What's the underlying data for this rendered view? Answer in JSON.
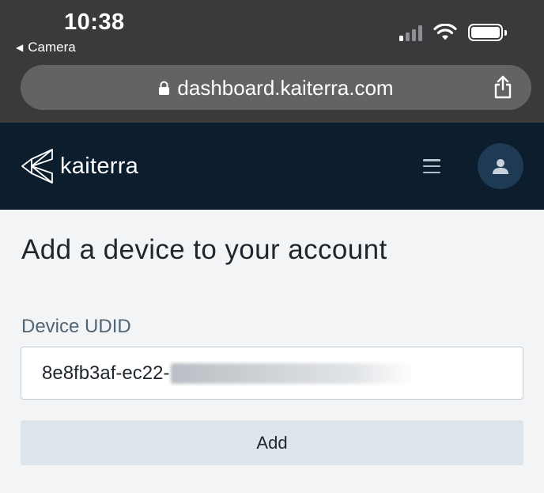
{
  "status_bar": {
    "time": "10:38",
    "back_app": "Camera"
  },
  "browser": {
    "url": "dashboard.kaiterra.com",
    "icons": [
      "lock-icon",
      "share-icon",
      "signal-icon",
      "wifi-icon",
      "battery-icon"
    ]
  },
  "app_header": {
    "logo_text": "kaiterra",
    "icons": [
      "kaiterra-logo-icon",
      "menu-icon",
      "user-icon"
    ]
  },
  "main": {
    "title": "Add a device to your account",
    "udid": {
      "label": "Device UDID",
      "value_visible": "8e8fb3af-ec22-"
    },
    "add_button": "Add"
  },
  "colors": {
    "chrome": "#3a3a3c",
    "url_bar": "#636366",
    "header_bg": "#0c1d2e",
    "avatar_bg": "#1e3a54",
    "page_bg": "#f3f4f6",
    "button_bg": "#dde4ea"
  }
}
